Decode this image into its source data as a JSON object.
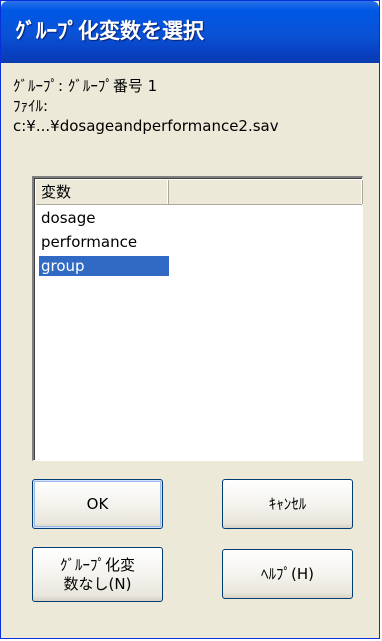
{
  "window": {
    "title": "ｸﾞﾙｰﾌﾟ化変数を選択"
  },
  "info": {
    "group_line": "ｸﾞﾙｰﾌﾟ: ｸﾞﾙｰﾌﾟ番号 1",
    "file_label": "ﾌｧｲﾙ:",
    "file_path": "c:¥...¥dosageandperformance2.sav"
  },
  "variable_list": {
    "column_header": "変数",
    "items": [
      {
        "label": "dosage",
        "selected": false
      },
      {
        "label": "performance",
        "selected": false
      },
      {
        "label": "group",
        "selected": true
      }
    ]
  },
  "buttons": {
    "ok": "OK",
    "cancel": "ｷｬﾝｾﾙ",
    "no_grouping": "ｸﾞﾙｰﾌﾟ化変\n数なし(N)",
    "help": "ﾍﾙﾌﾟ(H)"
  },
  "colors": {
    "titlebar": "#0a52d6",
    "dialog_bg": "#ece9d8",
    "selection": "#316ac5"
  }
}
